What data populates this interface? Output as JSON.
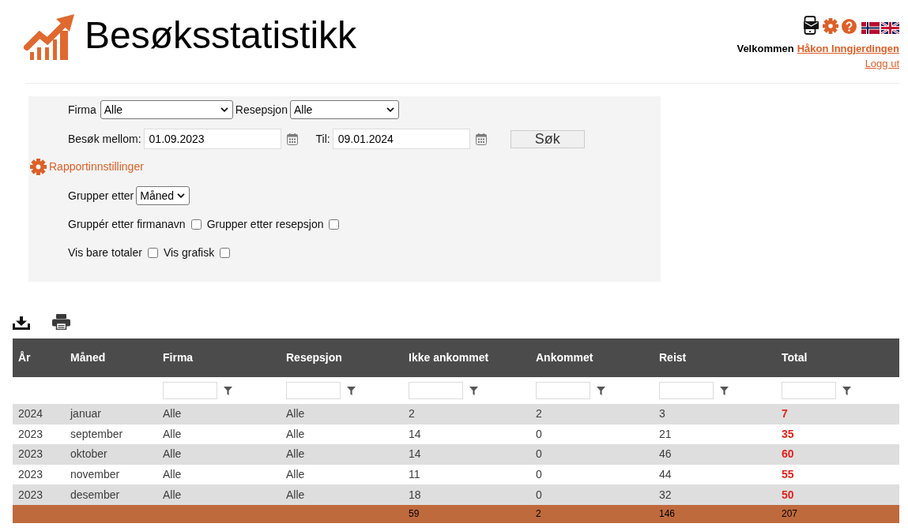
{
  "header": {
    "title": "Besøksstatistikk",
    "welcome_text": "Velkommen",
    "user_link": "Håkon Inngjerdingen",
    "logout_link": "Logg ut"
  },
  "search_form": {
    "company": {
      "label": "Firma",
      "value": "Alle"
    },
    "reception": {
      "label": "Resepsjon",
      "value": "Alle"
    },
    "date_from": {
      "label": "Besøk mellom:",
      "value": "01.09.2023"
    },
    "date_to": {
      "label": "Til:",
      "value": "09.01.2024"
    },
    "search_button": "Søk"
  },
  "report_settings": {
    "title": "Rapportinnstillinger",
    "group_by": {
      "label": "Grupper etter",
      "value": "Måned"
    },
    "option_rows": [
      [
        {
          "label": "Gruppér etter firmanavn",
          "checked": false
        },
        {
          "label": "Grupper etter resepsjon",
          "checked": false
        }
      ],
      [
        {
          "label": "Vis bare totaler",
          "checked": false
        },
        {
          "label": "Vis grafisk",
          "checked": false
        }
      ]
    ]
  },
  "table": {
    "columns": [
      {
        "label": "År",
        "has_filter": false
      },
      {
        "label": "Måned",
        "has_filter": false
      },
      {
        "label": "Firma",
        "has_filter": true
      },
      {
        "label": "Resepsjon",
        "has_filter": true
      },
      {
        "label": "Ikke ankommet",
        "has_filter": true
      },
      {
        "label": "Ankommet",
        "has_filter": true
      },
      {
        "label": "Reist",
        "has_filter": true
      },
      {
        "label": "Total",
        "has_filter": true
      }
    ],
    "rows": [
      [
        "2024",
        "januar",
        "Alle",
        "Alle",
        "2",
        "2",
        "3",
        "7"
      ],
      [
        "2023",
        "september",
        "Alle",
        "Alle",
        "14",
        "0",
        "21",
        "35"
      ],
      [
        "2023",
        "oktober",
        "Alle",
        "Alle",
        "14",
        "0",
        "46",
        "60"
      ],
      [
        "2023",
        "november",
        "Alle",
        "Alle",
        "11",
        "0",
        "44",
        "55"
      ],
      [
        "2023",
        "desember",
        "Alle",
        "Alle",
        "18",
        "0",
        "32",
        "50"
      ]
    ],
    "totals": [
      "59",
      "2",
      "146",
      "207"
    ]
  }
}
